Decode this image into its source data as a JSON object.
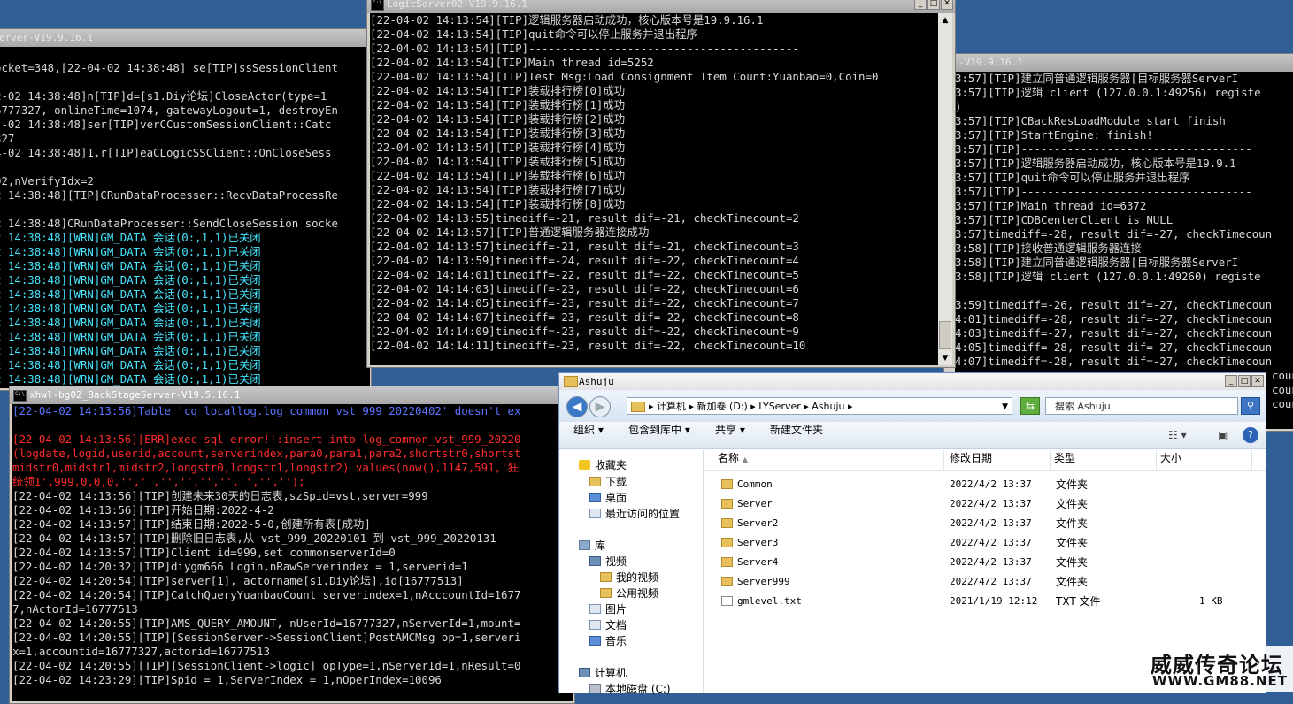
{
  "left_console": {
    "title": "erver-V19.9.16.1",
    "lines": [
      {
        "t": "",
        "c": ""
      },
      {
        "t": "ocket=348,[22-04-02 14:38:48] se[TIP]ssSessionClient",
        "c": ""
      },
      {
        "t": "",
        "c": ""
      },
      {
        "t": "2-02 14:38:48]n[TIP]d=[s1.Diy论坛]CloseActor(type=1",
        "c": ""
      },
      {
        "t": "6777327, onlineTime=1074, gatewayLogout=1, destroyEn",
        "c": ""
      },
      {
        "t": "4-02 14:38:48]ser[TIP]verCCustomSessionClient::Catc",
        "c": ""
      },
      {
        "t": "327",
        "c": ""
      },
      {
        "t": "4-02 14:38:48]1,r[TIP]eaCLogicSSClient::OnCloseSess",
        "c": ""
      },
      {
        "t": "",
        "c": ""
      },
      {
        "t": "02,nVerifyIdx=2",
        "c": ""
      },
      {
        "t": "2 14:38:48][TIP]CRunDataProcesser::RecvDataProcessRe",
        "c": ""
      },
      {
        "t": "",
        "c": ""
      },
      {
        "t": "2 14:38:48]CRunDataProcesser::SendCloseSession socke",
        "c": ""
      },
      {
        "t": "2 14:38:48][WRN]GM_DATA 会话(0:,1,1)已关闭",
        "c": "cyan"
      },
      {
        "t": "2 14:38:48][WRN]GM_DATA 会话(0:,1,1)已关闭",
        "c": "cyan"
      },
      {
        "t": "2 14:38:48][WRN]GM_DATA 会话(0:,1,1)已关闭",
        "c": "cyan"
      },
      {
        "t": "2 14:38:48][WRN]GM_DATA 会话(0:,1,1)已关闭",
        "c": "cyan"
      },
      {
        "t": "2 14:38:48][WRN]GM_DATA 会话(0:,1,1)已关闭",
        "c": "cyan"
      },
      {
        "t": "2 14:38:48][WRN]GM_DATA 会话(0:,1,1)已关闭",
        "c": "cyan"
      },
      {
        "t": "2 14:38:48][WRN]GM_DATA 会话(0:,1,1)已关闭",
        "c": "cyan"
      },
      {
        "t": "2 14:38:48][WRN]GM_DATA 会话(0:,1,1)已关闭",
        "c": "cyan"
      },
      {
        "t": "2 14:38:48][WRN]GM_DATA 会话(0:,1,1)已关闭",
        "c": "cyan"
      },
      {
        "t": "2 14:38:48][WRN]GM_DATA 会话(0:,1,1)已关闭",
        "c": "cyan"
      },
      {
        "t": "2 14:38:48][WRN]GM_DATA 会话(0:,1,1)已关闭",
        "c": "cyan"
      }
    ]
  },
  "logic_console": {
    "title": "LogicServer02-V19.9.16.1",
    "lines": [
      {
        "t": "[22-04-02 14:13:54][TIP]逻辑服务器启动成功，核心版本号是19.9.16.1",
        "c": ""
      },
      {
        "t": "[22-04-02 14:13:54][TIP]quit命令可以停止服务并退出程序",
        "c": ""
      },
      {
        "t": "[22-04-02 14:13:54][TIP]-----------------------------------------",
        "c": ""
      },
      {
        "t": "[22-04-02 14:13:54][TIP]Main thread id=5252",
        "c": ""
      },
      {
        "t": "[22-04-02 14:13:54][TIP]Test Msg:Load Consignment Item Count:Yuanbao=0,Coin=0",
        "c": ""
      },
      {
        "t": "[22-04-02 14:13:54][TIP]装载排行榜[0]成功",
        "c": ""
      },
      {
        "t": "[22-04-02 14:13:54][TIP]装载排行榜[1]成功",
        "c": ""
      },
      {
        "t": "[22-04-02 14:13:54][TIP]装载排行榜[2]成功",
        "c": ""
      },
      {
        "t": "[22-04-02 14:13:54][TIP]装载排行榜[3]成功",
        "c": ""
      },
      {
        "t": "[22-04-02 14:13:54][TIP]装载排行榜[4]成功",
        "c": ""
      },
      {
        "t": "[22-04-02 14:13:54][TIP]装载排行榜[5]成功",
        "c": ""
      },
      {
        "t": "[22-04-02 14:13:54][TIP]装载排行榜[6]成功",
        "c": ""
      },
      {
        "t": "[22-04-02 14:13:54][TIP]装载排行榜[7]成功",
        "c": ""
      },
      {
        "t": "[22-04-02 14:13:54][TIP]装载排行榜[8]成功",
        "c": ""
      },
      {
        "t": "[22-04-02 14:13:55]timediff=-21, result dif=-21, checkTimecount=2",
        "c": ""
      },
      {
        "t": "[22-04-02 14:13:57][TIP]普通逻辑服务器连接成功",
        "c": ""
      },
      {
        "t": "[22-04-02 14:13:57]timediff=-21, result dif=-21, checkTimecount=3",
        "c": ""
      },
      {
        "t": "[22-04-02 14:13:59]timediff=-24, result dif=-22, checkTimecount=4",
        "c": ""
      },
      {
        "t": "[22-04-02 14:14:01]timediff=-22, result dif=-22, checkTimecount=5",
        "c": ""
      },
      {
        "t": "[22-04-02 14:14:03]timediff=-23, result dif=-22, checkTimecount=6",
        "c": ""
      },
      {
        "t": "[22-04-02 14:14:05]timediff=-23, result dif=-22, checkTimecount=7",
        "c": ""
      },
      {
        "t": "[22-04-02 14:14:07]timediff=-23, result dif=-22, checkTimecount=8",
        "c": ""
      },
      {
        "t": "[22-04-02 14:14:09]timediff=-23, result dif=-22, checkTimecount=9",
        "c": ""
      },
      {
        "t": "[22-04-02 14:14:11]timediff=-23, result dif=-22, checkTimecount=10",
        "c": ""
      }
    ]
  },
  "right_console": {
    "title": "-V19.9.16.1",
    "lines": [
      {
        "t": "3:57][TIP]建立同普通逻辑服务器[目标服务器ServerI",
        "c": ""
      },
      {
        "t": "3:57][TIP]逻辑 client (127.0.0.1:49256) registe",
        "c": ""
      },
      {
        "t": ")",
        "c": ""
      },
      {
        "t": "3:57][TIP]CBackResLoadModule start finish",
        "c": ""
      },
      {
        "t": "3:57][TIP]StartEngine: finish!",
        "c": ""
      },
      {
        "t": "3:57][TIP]-----------------------------------",
        "c": ""
      },
      {
        "t": "3:57][TIP]逻辑服务器启动成功，核心版本号是19.9.1",
        "c": ""
      },
      {
        "t": "3:57][TIP]quit命令可以停止服务并退出程序",
        "c": ""
      },
      {
        "t": "3:57][TIP]-----------------------------------",
        "c": ""
      },
      {
        "t": "3:57][TIP]Main thread id=6372",
        "c": ""
      },
      {
        "t": "3:57][TIP]CDBCenterClient is NULL",
        "c": ""
      },
      {
        "t": "3:57]timediff=-28, result dif=-27, checkTimecoun",
        "c": ""
      },
      {
        "t": "3:58][TIP]接收普通逻辑服务器连接",
        "c": ""
      },
      {
        "t": "3:58][TIP]建立同普通逻辑服务器[目标服务器ServerI",
        "c": ""
      },
      {
        "t": "3:58][TIP]逻辑 client (127.0.0.1:49260) registe",
        "c": ""
      },
      {
        "t": "",
        "c": ""
      },
      {
        "t": "3:59]timediff=-26, result dif=-27, checkTimecoun",
        "c": ""
      },
      {
        "t": "4:01]timediff=-28, result dif=-27, checkTimecoun",
        "c": ""
      },
      {
        "t": "4:03]timediff=-27, result dif=-27, checkTimecoun",
        "c": ""
      },
      {
        "t": "4:05]timediff=-28, result dif=-27, checkTimecoun",
        "c": ""
      },
      {
        "t": "4:07]timediff=-28, result dif=-27, checkTimecoun",
        "c": ""
      },
      {
        "t": "",
        "c": ""
      },
      {
        "t": "",
        "c": ""
      },
      {
        "t": "",
        "c": ""
      }
    ],
    "tail_lines": [
      "coun",
      "coun",
      "coun",
      "coun"
    ]
  },
  "backstage_console": {
    "title": "xhwl-bg02_BackStageServer-V19.5.16.1",
    "lines": [
      {
        "t": "[22-04-02 14:13:56]Table 'cq_locallog.log_common_vst_999_20220402' doesn't ex",
        "c": "blue"
      },
      {
        "t": "",
        "c": ""
      },
      {
        "t": "[22-04-02 14:13:56][ERR]exec sql error!!:insert into log_common_vst_999_20220",
        "c": "red"
      },
      {
        "t": "(logdate,logid,userid,account,serverindex,para0,para1,para2,shortstr0,shortst",
        "c": "red"
      },
      {
        "t": "midstr0,midstr1,midstr2,longstr0,longstr1,longstr2) values(now(),1147,591,'狂",
        "c": "red"
      },
      {
        "t": "统领1',999,0,0,0,'','','','','','','','','');",
        "c": "red"
      },
      {
        "t": "[22-04-02 14:13:56][TIP]创建未来30天的日志表,szSpid=vst,server=999",
        "c": ""
      },
      {
        "t": "[22-04-02 14:13:56][TIP]开始日期:2022-4-2",
        "c": ""
      },
      {
        "t": "[22-04-02 14:13:57][TIP]结束日期:2022-5-0,创建所有表[成功]",
        "c": ""
      },
      {
        "t": "[22-04-02 14:13:57][TIP]删除旧日志表,从 vst_999_20220101 到 vst_999_20220131",
        "c": ""
      },
      {
        "t": "[22-04-02 14:13:57][TIP]Client id=999,set commonserverId=0",
        "c": ""
      },
      {
        "t": "[22-04-02 14:20:32][TIP]diygm666 Login,nRawServerindex = 1,serverid=1",
        "c": ""
      },
      {
        "t": "[22-04-02 14:20:54][TIP]server[1], actorname[s1.Diy论坛],id[16777513]",
        "c": ""
      },
      {
        "t": "[22-04-02 14:20:54][TIP]CatchQueryYuanbaoCount serverindex=1,nAcccountId=1677",
        "c": ""
      },
      {
        "t": "7,nActorId=16777513",
        "c": ""
      },
      {
        "t": "[22-04-02 14:20:55][TIP]AMS_QUERY_AMOUNT, nUserId=16777327,nServerId=1,mount=",
        "c": ""
      },
      {
        "t": "[22-04-02 14:20:55][TIP][SessionServer->SessionClient]PostAMCMsg op=1,serveri",
        "c": ""
      },
      {
        "t": "x=1,accountid=16777327,actorid=16777513",
        "c": ""
      },
      {
        "t": "[22-04-02 14:20:55][TIP][SessionClient->logic] opType=1,nServerId=1,nResult=0",
        "c": ""
      },
      {
        "t": "[22-04-02 14:23:29][TIP]Spid = 1,ServerIndex = 1,nOperIndex=10096",
        "c": ""
      }
    ]
  },
  "explorer": {
    "title": "Ashuju",
    "address": "▸ 计算机 ▸ 新加卷 (D:) ▸ LYServer ▸ Ashuju ▸",
    "search_placeholder": "搜索 Ashuju",
    "toolbar": {
      "organize": "组织 ▾",
      "include_in_library": "包含到库中 ▾",
      "share": "共享 ▾",
      "new_folder": "新建文件夹"
    },
    "nav": {
      "favorites": "收藏夹",
      "downloads": "下载",
      "desktop": "桌面",
      "recent": "最近访问的位置",
      "libraries": "库",
      "videos": "视频",
      "my_videos": "我的视频",
      "public_videos": "公用视频",
      "pictures": "图片",
      "documents": "文档",
      "music": "音乐",
      "computer": "计算机",
      "local_disk": "本地磁盘 (C:)"
    },
    "columns": {
      "name": "名称",
      "modified": "修改日期",
      "type": "类型",
      "size": "大小"
    },
    "rows": [
      {
        "name": "Common",
        "modified": "2022/4/2 13:37",
        "type": "文件夹",
        "size": "",
        "kind": "folder"
      },
      {
        "name": "Server",
        "modified": "2022/4/2 13:37",
        "type": "文件夹",
        "size": "",
        "kind": "folder"
      },
      {
        "name": "Server2",
        "modified": "2022/4/2 13:37",
        "type": "文件夹",
        "size": "",
        "kind": "folder"
      },
      {
        "name": "Server3",
        "modified": "2022/4/2 13:37",
        "type": "文件夹",
        "size": "",
        "kind": "folder"
      },
      {
        "name": "Server4",
        "modified": "2022/4/2 13:37",
        "type": "文件夹",
        "size": "",
        "kind": "folder"
      },
      {
        "name": "Server999",
        "modified": "2022/4/2 13:37",
        "type": "文件夹",
        "size": "",
        "kind": "folder"
      },
      {
        "name": "gmlevel.txt",
        "modified": "2021/1/19 12:12",
        "type": "TXT 文件",
        "size": "1 KB",
        "kind": "txt"
      }
    ]
  },
  "watermark": {
    "line1": "威威传奇论坛",
    "line2": "WWW.GM88.NET"
  }
}
